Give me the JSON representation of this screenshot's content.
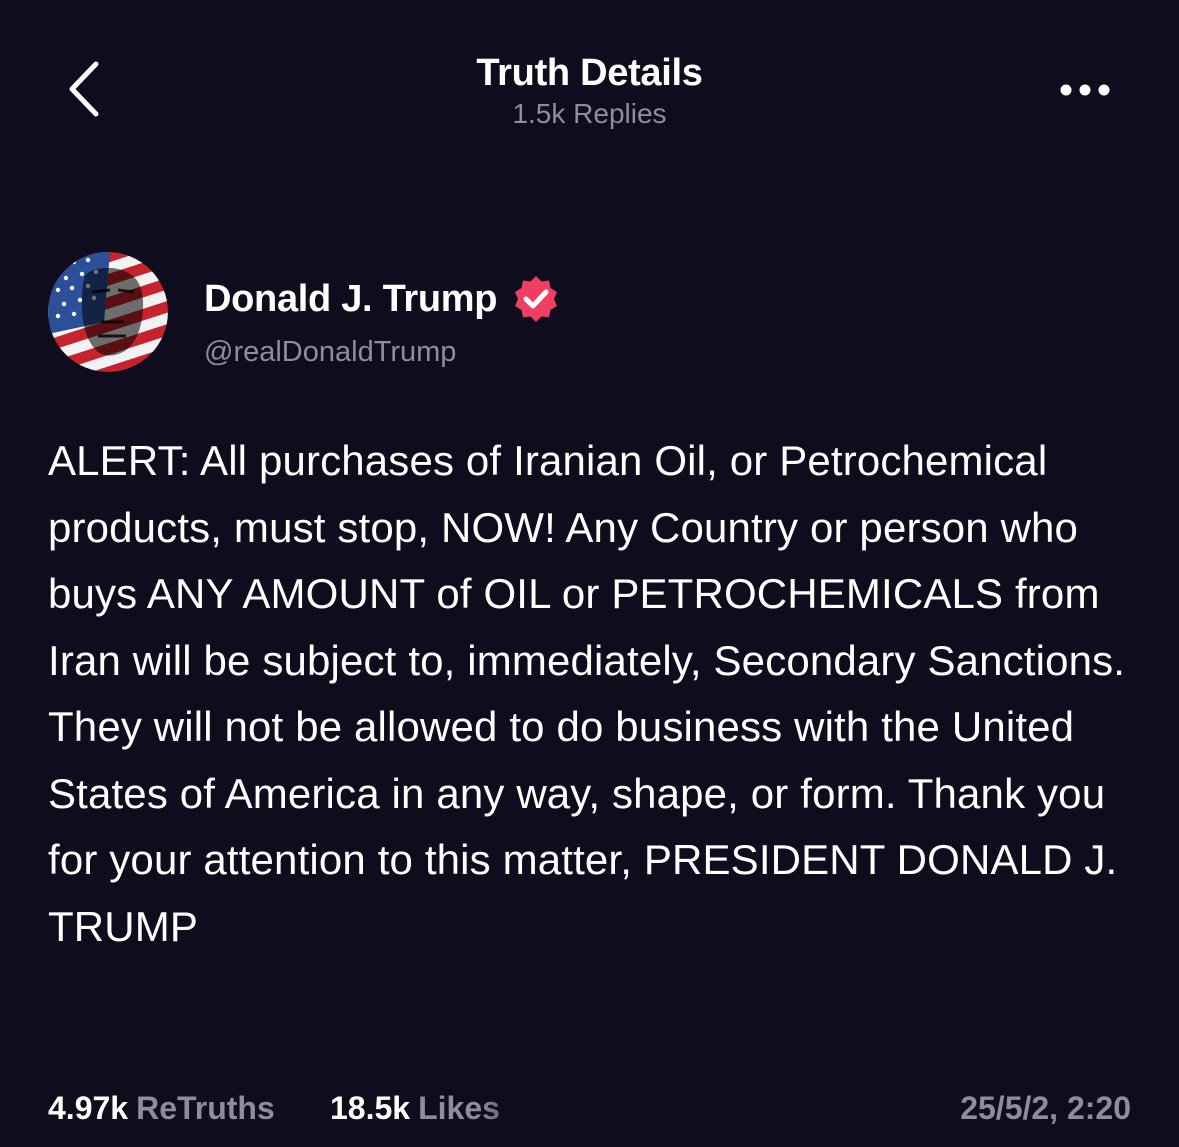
{
  "header": {
    "title": "Truth Details",
    "subtitle": "1.5k Replies",
    "back_icon": "chevron-left-icon",
    "more_icon": "ellipsis-icon"
  },
  "author": {
    "name": "Donald J. Trump",
    "handle": "@realDonaldTrump",
    "verified": true,
    "badge_color": "#f03e63"
  },
  "post": {
    "text": "ALERT: All purchases of Iranian Oil, or Petrochemical products, must stop, NOW! Any Country or person who buys ANY AMOUNT of OIL or PETROCHEMICALS from Iran will be subject to, immediately, Secondary Sanctions. They will not be allowed to do business with the United States of America in any way, shape, or form. Thank you for your attention to this matter, PRESIDENT DONALD J. TRUMP"
  },
  "stats": {
    "retruths_count": "4.97k",
    "retruths_label": "ReTruths",
    "likes_count": "18.5k",
    "likes_label": "Likes",
    "timestamp": "25/5/2, 2:20"
  },
  "colors": {
    "background": "#0f0c1e",
    "text_primary": "#ffffff",
    "text_secondary": "#8f8c9e",
    "verified": "#f03e63"
  }
}
